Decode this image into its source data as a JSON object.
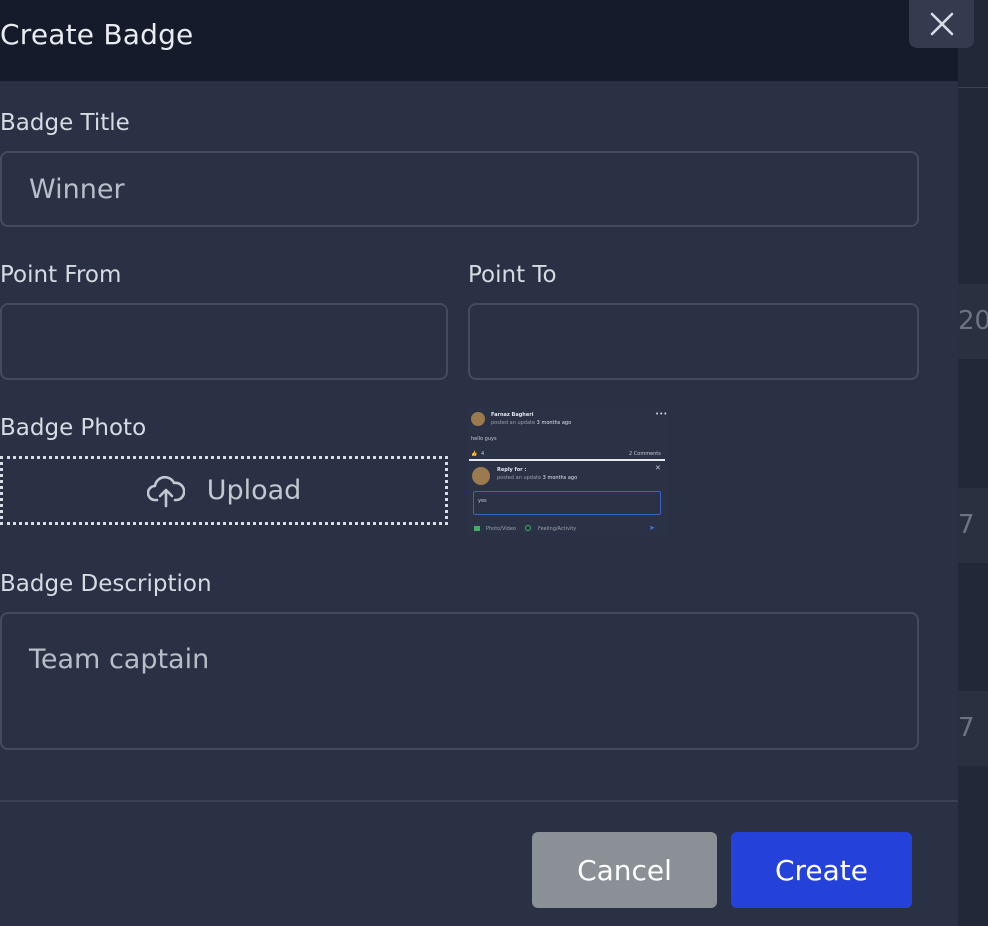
{
  "modal": {
    "title": "Create Badge",
    "close_icon": "close-icon"
  },
  "form": {
    "badge_title": {
      "label": "Badge Title",
      "value": "Winner"
    },
    "point_from": {
      "label": "Point From",
      "value": ""
    },
    "point_to": {
      "label": "Point To",
      "value": ""
    },
    "badge_photo": {
      "label": "Badge Photo",
      "upload_label": "Upload",
      "upload_icon": "cloud-upload-icon"
    },
    "badge_description": {
      "label": "Badge Description",
      "value": "Team captain"
    }
  },
  "photo_preview": {
    "author": "Farnaz Bagheri",
    "posted": "posted an update",
    "time": "3 months ago",
    "text": "hello guys",
    "likes": "4",
    "comments": "2 Comments",
    "reply_to": "Reply for :",
    "reply_posted": "posted an update",
    "reply_time": "3 months ago",
    "reply_input": "yes",
    "action_photo": "Photo/Video",
    "action_feeling": "Feeling/Activity"
  },
  "footer": {
    "cancel_label": "Cancel",
    "create_label": "Create"
  },
  "background_cells": [
    "20",
    "7",
    "7"
  ],
  "colors": {
    "header_bg": "#161b2b",
    "modal_bg": "#2b3145",
    "primary": "#2442d9",
    "secondary": "#8b8f96"
  }
}
